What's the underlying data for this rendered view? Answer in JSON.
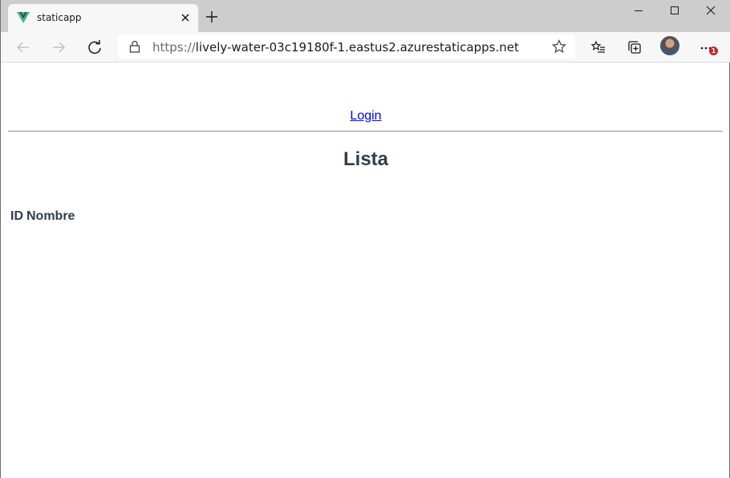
{
  "browser": {
    "tab": {
      "title": "staticapp"
    },
    "address": {
      "scheme": "https://",
      "host": "lively-water-03c19180f-1.eastus2.azurestaticapps.net"
    },
    "notification_badge": "1"
  },
  "page": {
    "nav": {
      "login_link": "Login"
    },
    "heading": "Lista",
    "table": {
      "headers": [
        "ID",
        "Nombre"
      ]
    }
  }
}
